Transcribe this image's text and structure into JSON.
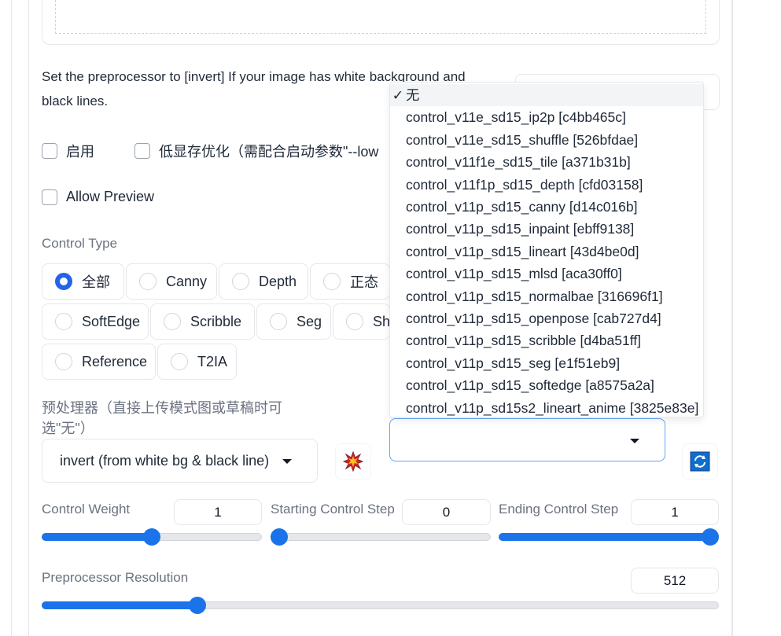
{
  "hint_text": "Set the preprocessor to [invert] If your image has white background and black lines.",
  "checkboxes": {
    "enable": "启用",
    "low_vram": "低显存优化（需配合启动参数\"--low",
    "allow_preview": "Allow Preview"
  },
  "control_type": {
    "label": "Control Type",
    "options": [
      "全部",
      "Canny",
      "Depth",
      "正态",
      "SoftEdge",
      "Scribble",
      "Seg",
      "Shu",
      "Reference",
      "T2IA"
    ],
    "selected": "全部"
  },
  "preprocessor": {
    "label": "预处理器（直接上传模式图或草稿时可选\"无\"）",
    "value": "invert (from white bg & black line)"
  },
  "model": {
    "value": "",
    "dropdown_items": [
      "无",
      "control_v11e_sd15_ip2p [c4bb465c]",
      "control_v11e_sd15_shuffle [526bfdae]",
      "control_v11f1e_sd15_tile [a371b31b]",
      "control_v11f1p_sd15_depth [cfd03158]",
      "control_v11p_sd15_canny [d14c016b]",
      "control_v11p_sd15_inpaint [ebff9138]",
      "control_v11p_sd15_lineart [43d4be0d]",
      "control_v11p_sd15_mlsd [aca30ff0]",
      "control_v11p_sd15_normalbae [316696f1]",
      "control_v11p_sd15_openpose [cab727d4]",
      "control_v11p_sd15_scribble [d4ba51ff]",
      "control_v11p_sd15_seg [e1f51eb9]",
      "control_v11p_sd15_softedge [a8575a2a]",
      "control_v11p_sd15s2_lineart_anime [3825e83e]"
    ],
    "selected_mark": "✓"
  },
  "sliders": {
    "control_weight": {
      "label": "Control Weight",
      "value": "1",
      "fraction": 0.5
    },
    "starting_step": {
      "label": "Starting Control Step",
      "value": "0",
      "fraction": 0.0
    },
    "ending_step": {
      "label": "Ending Control Step",
      "value": "1",
      "fraction": 1.0
    },
    "preprocessor_resolution": {
      "label": "Preprocessor Resolution",
      "value": "512",
      "fraction": 0.23
    }
  },
  "colors": {
    "accent": "#1a73e8",
    "radio_selected": "#2563eb",
    "refresh_bg": "#0b6fcf"
  },
  "icons": {
    "run_preprocessor": "explosion-icon",
    "refresh": "refresh-icon"
  }
}
